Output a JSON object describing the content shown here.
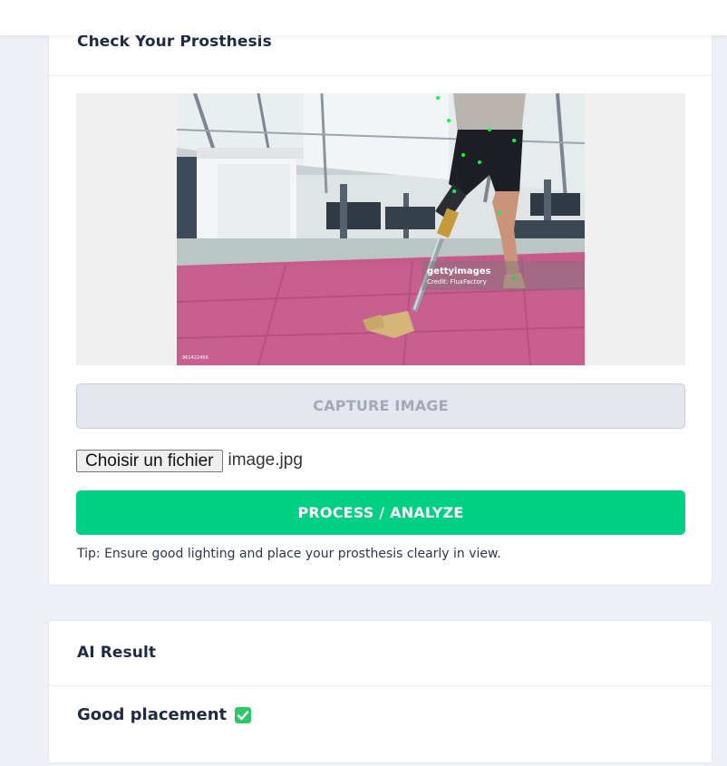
{
  "prosthesis_card": {
    "title": "Check Your Prosthesis",
    "photo": {
      "watermark_brand": "gettyimages",
      "watermark_credit": "Credit: FluxFactory",
      "image_id": "961422456"
    },
    "capture_button": "CAPTURE IMAGE",
    "file_input": {
      "button_label": "Choisir un fichier",
      "file_name": "image.jpg"
    },
    "process_button": "PROCESS / ANALYZE",
    "tip": "Tip: Ensure good lighting and place your prosthesis clearly in view."
  },
  "result_card": {
    "title": "AI Result",
    "result_text": "Good placement",
    "result_icon": "check-mark-icon"
  },
  "colors": {
    "accent_green": "#00d084",
    "check_green": "#2ec76b",
    "background": "#eef0f7"
  }
}
